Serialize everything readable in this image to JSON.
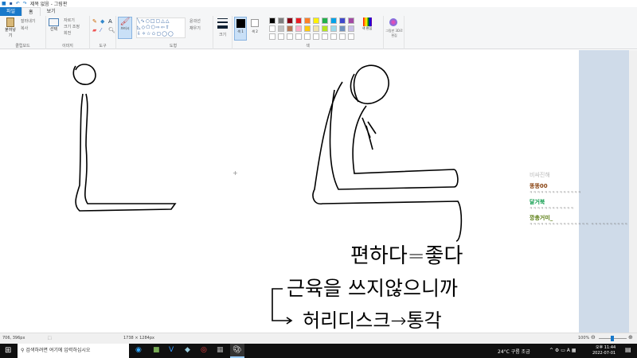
{
  "window": {
    "title": "제목 없음 - 그림판"
  },
  "tabs": [
    "파일",
    "홈",
    "보기"
  ],
  "ribbon": {
    "clipboard": {
      "paste": "붙여넣기",
      "cut": "잘라내기",
      "copy": "복사",
      "label": "클립보드"
    },
    "image": {
      "select": "선택",
      "crop": "자르기",
      "resize": "크기 조정",
      "rotate": "회전",
      "label": "이미지"
    },
    "tools": {
      "label": "도구"
    },
    "brush": {
      "label": "브러시"
    },
    "shapes": {
      "outline": "윤곽선",
      "fill": "채우기",
      "label": "도형"
    },
    "size": {
      "label": "크기"
    },
    "colors": {
      "color1": "색 1",
      "color2": "색 2",
      "edit": "색 편집",
      "label": "색",
      "palette": [
        "#000000",
        "#7f7f7f",
        "#880015",
        "#ed1c24",
        "#ff7f27",
        "#fff200",
        "#22b14c",
        "#00a2e8",
        "#3f48cc",
        "#a349a4",
        "#ffffff",
        "#c3c3c3",
        "#b97a57",
        "#ffaec9",
        "#ffc90e",
        "#efe4b0",
        "#b5e61d",
        "#99d9ea",
        "#7092be",
        "#c8bfe7"
      ]
    },
    "paint3d": "그림판 3D로 편집"
  },
  "canvas": {
    "texts": [
      "편하다=좋다",
      "근육을 쓰지않으니까",
      "허리디스크→통각"
    ]
  },
  "chat": {
    "header": "비싸진해",
    "messages": [
      {
        "nick": "똥똥00",
        "color": "#8b4513",
        "text": "ㅋㅋㅋㅋㅋㅋㅋㅋㅋㅋㅋㅋㅋㅋ"
      },
      {
        "nick": "달거북",
        "color": "#0b9b4a",
        "text": "ㅋㅋㅋㅋㅋㅋㅋㅋㅋㅋㅋㅋ"
      },
      {
        "nick": "깡총거미_",
        "color": "#5a7d12",
        "text": "ㅋㅋㅋㅋㅋㅋㅋㅋㅋㅋㅋㅋㅋㅋㅋㅋ ㅋㅋㅋㅋㅋㅋㅋㅋㅋㅋ"
      }
    ]
  },
  "status": {
    "cursor": "706, 396px",
    "canvas_size": "1738 × 1284px",
    "zoom": "100%"
  },
  "taskbar": {
    "search_placeholder": "검색하려면 여기에 입력하십시오",
    "weather": "24°C 구름 조금",
    "time": "오후 11:44",
    "date": "2022-07-01"
  }
}
